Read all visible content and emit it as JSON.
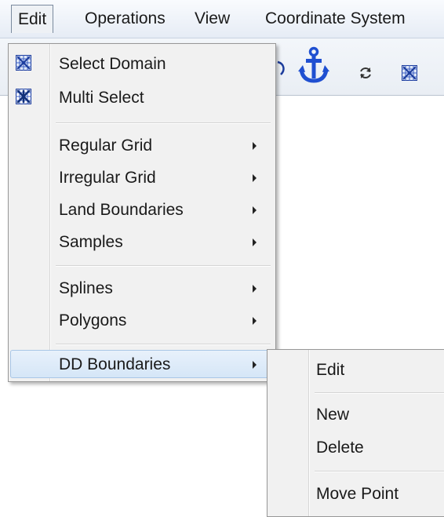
{
  "menubar": {
    "items": [
      {
        "label": "Edit"
      },
      {
        "label": "Operations"
      },
      {
        "label": "View"
      },
      {
        "label": "Coordinate System"
      }
    ]
  },
  "toolbar": {
    "icons": [
      "refresh-icon",
      "anchor-icon",
      "rotate-icon",
      "grid-pattern-icon"
    ]
  },
  "edit_menu": {
    "items": [
      {
        "label": "Select Domain",
        "icon": "grid-pattern-icon"
      },
      {
        "label": "Multi Select",
        "icon": "multi-grid-pattern-icon"
      },
      {
        "label": "Regular Grid",
        "submenu": true
      },
      {
        "label": "Irregular Grid",
        "submenu": true
      },
      {
        "label": "Land Boundaries",
        "submenu": true
      },
      {
        "label": "Samples",
        "submenu": true
      },
      {
        "label": "Splines",
        "submenu": true
      },
      {
        "label": "Polygons",
        "submenu": true
      },
      {
        "label": "DD Boundaries",
        "submenu": true,
        "highlighted": true
      }
    ]
  },
  "dd_submenu": {
    "items": [
      {
        "label": "Edit"
      },
      {
        "label": "New"
      },
      {
        "label": "Delete"
      },
      {
        "label": "Move Point"
      }
    ]
  },
  "colors": {
    "anchor_blue": "#1f4fd1",
    "icon_blue": "#1c3c9c",
    "highlight": "#d5e6f7"
  }
}
